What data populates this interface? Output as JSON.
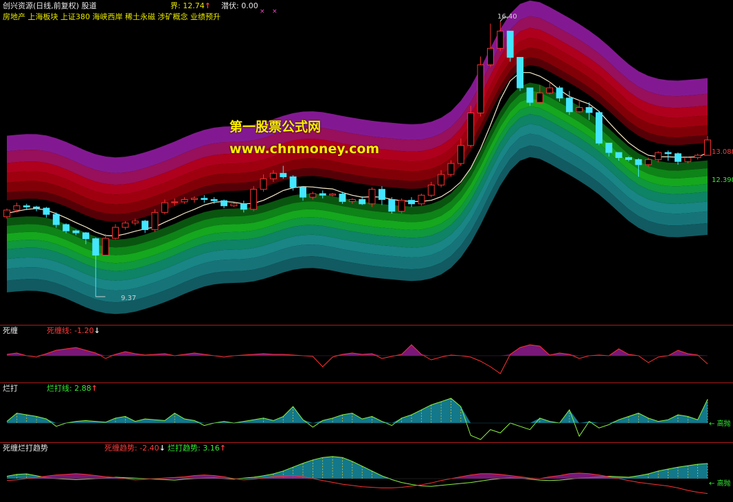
{
  "header": {
    "title": "创兴资源(日线,前复权)",
    "source": "股道",
    "jie_label": "界: ",
    "jie_value": "12.74",
    "jie_arrow": "↑",
    "qianfu_label": "潜伏: ",
    "qianfu_value": "0.00",
    "concepts": "房地产 上海板块 上证380 海峡西岸 稀土永磁 涉矿概念 业绩预升"
  },
  "watermark": {
    "line1": "第一股票公式网",
    "line2": "www.chnmoney.com"
  },
  "main_chart": {
    "price_high_label": "16.40",
    "price_low_label": "9.37",
    "right_label_top": "13.088",
    "right_label_bottom": "12.398",
    "colors": {
      "up": "#ff3030",
      "down": "#44e6ff",
      "ma": "#f4e9c8"
    }
  },
  "panel1": {
    "name": "死缠",
    "line_label": "死缠线: ",
    "line_value": "-1.20",
    "arrow": "↓"
  },
  "panel2": {
    "name": "烂打",
    "line_label": "烂打线: ",
    "line_value": "2.88",
    "arrow": "↑",
    "right_label": "高抛"
  },
  "panel3": {
    "name": "死缠烂打趋势",
    "trend1_label": "死缠趋势: ",
    "trend1_value": "-2.40",
    "trend1_arrow": "↓",
    "trend2_label": "烂打趋势: ",
    "trend2_value": "3.16",
    "trend2_arrow": "↑",
    "right_label": "高抛"
  },
  "chart_data": [
    {
      "type": "candlestick",
      "title": "创兴资源(日线,前复权)",
      "series": [
        {
          "name": "price",
          "candles": [
            [
              11.41,
              11.58,
              11.62,
              11.36
            ],
            [
              11.58,
              11.69,
              11.77,
              11.52
            ],
            [
              11.69,
              11.66,
              11.74,
              11.58
            ],
            [
              11.66,
              11.63,
              11.69,
              11.55
            ],
            [
              11.63,
              11.47,
              11.66,
              11.39
            ],
            [
              11.47,
              11.21,
              11.52,
              11.13
            ],
            [
              11.21,
              11.05,
              11.24,
              10.99
            ],
            [
              11.05,
              11.0,
              11.08,
              10.94
            ],
            [
              11.0,
              10.85,
              11.02,
              10.71
            ],
            [
              10.85,
              10.43,
              10.88,
              9.37
            ],
            [
              10.43,
              10.86,
              10.97,
              10.4
            ],
            [
              10.86,
              11.14,
              11.22,
              10.83
            ],
            [
              11.14,
              11.25,
              11.3,
              11.08
            ],
            [
              11.25,
              11.3,
              11.36,
              11.19
            ],
            [
              11.3,
              11.08,
              11.33,
              11.0
            ],
            [
              11.08,
              11.52,
              11.6,
              11.02
            ],
            [
              11.52,
              11.77,
              11.85,
              11.47
            ],
            [
              11.77,
              11.79,
              11.88,
              11.69
            ],
            [
              11.79,
              11.85,
              11.91,
              11.74
            ],
            [
              11.85,
              11.88,
              11.93,
              11.77
            ],
            [
              11.88,
              11.85,
              11.96,
              11.77
            ],
            [
              11.85,
              11.82,
              11.91,
              11.74
            ],
            [
              11.82,
              11.69,
              11.85,
              11.63
            ],
            [
              11.69,
              11.74,
              11.77,
              11.66
            ],
            [
              11.74,
              11.6,
              11.82,
              11.52
            ],
            [
              11.6,
              12.11,
              12.19,
              11.55
            ],
            [
              12.11,
              12.38,
              12.49,
              12.05
            ],
            [
              12.38,
              12.52,
              12.6,
              12.3
            ],
            [
              12.52,
              12.43,
              12.71,
              12.38
            ],
            [
              12.43,
              12.16,
              12.47,
              12.08
            ],
            [
              12.16,
              11.91,
              12.19,
              11.82
            ],
            [
              11.91,
              12.0,
              12.05,
              11.85
            ],
            [
              12.0,
              11.96,
              12.08,
              11.88
            ],
            [
              11.96,
              11.99,
              12.02,
              11.93
            ],
            [
              11.99,
              11.8,
              12.05,
              11.74
            ],
            [
              11.8,
              11.85,
              11.88,
              11.74
            ],
            [
              11.85,
              11.74,
              11.93,
              11.71
            ],
            [
              11.74,
              12.11,
              12.16,
              11.66
            ],
            [
              12.11,
              11.85,
              12.19,
              11.71
            ],
            [
              11.85,
              11.55,
              11.91,
              11.49
            ],
            [
              11.55,
              11.83,
              11.88,
              11.49
            ],
            [
              11.83,
              11.74,
              11.91,
              11.66
            ],
            [
              11.74,
              11.96,
              12.0,
              11.69
            ],
            [
              11.96,
              12.22,
              12.3,
              11.91
            ],
            [
              12.22,
              12.49,
              12.6,
              12.16
            ],
            [
              12.49,
              12.77,
              12.85,
              12.43
            ],
            [
              12.77,
              13.23,
              13.41,
              12.71
            ],
            [
              13.23,
              14.06,
              14.24,
              13.18
            ],
            [
              14.06,
              15.29,
              15.5,
              13.97
            ],
            [
              15.29,
              15.71,
              16.34,
              15.23
            ],
            [
              15.71,
              16.15,
              16.4,
              15.64
            ],
            [
              16.15,
              15.48,
              15.84,
              15.37
            ],
            [
              15.48,
              14.7,
              14.86,
              14.62
            ],
            [
              14.7,
              14.33,
              14.64,
              14.24
            ],
            [
              14.33,
              14.57,
              14.77,
              14.27
            ],
            [
              14.57,
              14.7,
              14.86,
              14.53
            ],
            [
              14.7,
              14.44,
              14.75,
              14.35
            ],
            [
              14.44,
              14.09,
              14.62,
              14.01
            ],
            [
              14.09,
              14.2,
              14.4,
              14.07
            ],
            [
              14.2,
              14.07,
              14.33,
              13.88
            ],
            [
              14.07,
              13.29,
              14.12,
              13.24
            ],
            [
              13.29,
              13.05,
              13.21,
              12.95
            ],
            [
              13.05,
              12.92,
              13.02,
              12.84
            ],
            [
              12.92,
              12.87,
              12.95,
              12.82
            ],
            [
              12.87,
              12.74,
              12.9,
              12.43
            ],
            [
              12.74,
              12.87,
              12.92,
              12.68
            ],
            [
              12.87,
              13.05,
              13.08,
              12.8
            ],
            [
              13.05,
              13.02,
              13.1,
              12.84
            ],
            [
              13.02,
              12.82,
              13.05,
              12.74
            ],
            [
              12.82,
              12.92,
              12.95,
              12.77
            ],
            [
              12.92,
              12.98,
              13.02,
              12.87
            ],
            [
              12.98,
              13.37,
              13.47,
              12.98
            ]
          ]
        },
        {
          "name": "MA",
          "values": [
            11.5,
            11.55,
            11.6,
            11.62,
            11.58,
            11.49,
            11.38,
            11.26,
            11.15,
            11.02,
            10.93,
            10.92,
            10.97,
            11.04,
            11.1,
            11.15,
            11.27,
            11.38,
            11.5,
            11.6,
            11.71,
            11.78,
            11.8,
            11.78,
            11.74,
            11.75,
            11.83,
            11.95,
            12.08,
            12.15,
            12.18,
            12.17,
            12.14,
            12.12,
            12.03,
            11.96,
            11.91,
            11.92,
            11.91,
            11.85,
            11.82,
            11.8,
            11.8,
            11.83,
            11.92,
            12.08,
            12.3,
            12.65,
            13.15,
            13.75,
            14.4,
            14.88,
            15.09,
            15.09,
            15.0,
            14.85,
            14.65,
            14.48,
            14.38,
            14.29,
            14.1,
            13.82,
            13.55,
            13.3,
            13.12,
            12.98,
            12.94,
            12.94,
            12.93,
            12.93,
            12.94,
            13.04
          ]
        }
      ]
    },
    {
      "type": "line",
      "title": "死缠",
      "series": [
        {
          "name": "死缠线",
          "values": [
            0.2,
            0.4,
            0.0,
            -0.2,
            0.3,
            0.8,
            1.0,
            1.2,
            0.8,
            0.4,
            -0.4,
            0.2,
            0.6,
            0.3,
            0.1,
            0.2,
            0.3,
            0.0,
            0.2,
            0.4,
            0.2,
            0.0,
            -0.2,
            0.0,
            0.1,
            0.2,
            0.3,
            0.2,
            0.2,
            0.1,
            0.0,
            -0.1,
            -1.6,
            -0.2,
            0.2,
            0.4,
            0.2,
            0.3,
            -0.4,
            -0.1,
            0.2,
            1.6,
            0.2,
            -0.6,
            -0.2,
            0.1,
            0.0,
            -0.2,
            -0.8,
            -1.6,
            -2.6,
            0.2,
            1.2,
            1.6,
            1.4,
            0.1,
            0.4,
            0.2,
            -0.4,
            0.0,
            0.1,
            0.0,
            1.0,
            0.2,
            0.0,
            -1.0,
            -0.2,
            0.0,
            0.8,
            0.3,
            0.1,
            -1.2
          ]
        }
      ]
    },
    {
      "type": "line",
      "title": "烂打",
      "series": [
        {
          "name": "烂打线",
          "values": [
            0.2,
            1.2,
            1.0,
            0.8,
            0.5,
            -0.4,
            0.0,
            0.2,
            0.3,
            0.2,
            0.1,
            0.6,
            0.8,
            0.2,
            0.5,
            0.4,
            0.3,
            1.2,
            0.5,
            0.3,
            -0.3,
            0.0,
            0.2,
            0.0,
            0.2,
            0.4,
            0.6,
            0.3,
            0.8,
            2.0,
            0.4,
            -0.5,
            0.3,
            0.6,
            1.0,
            1.2,
            0.5,
            0.8,
            0.2,
            -0.3,
            0.6,
            1.0,
            1.6,
            2.2,
            2.6,
            3.0,
            2.0,
            -1.5,
            -2.0,
            -0.8,
            -1.2,
            0.0,
            -0.4,
            -0.8,
            0.6,
            0.2,
            0.0,
            1.6,
            -1.6,
            0.2,
            -0.6,
            -0.2,
            0.4,
            0.8,
            1.2,
            0.6,
            0.2,
            0.4,
            1.0,
            0.8,
            0.4,
            2.88
          ]
        }
      ]
    },
    {
      "type": "line",
      "title": "死缠烂打趋势",
      "series": [
        {
          "name": "死缠趋势",
          "values": [
            -0.3,
            -0.2,
            0.0,
            0.2,
            0.4,
            0.6,
            0.7,
            0.8,
            0.7,
            0.5,
            0.3,
            0.2,
            0.0,
            -0.2,
            -0.1,
            0.0,
            0.1,
            0.2,
            0.3,
            0.5,
            0.6,
            0.5,
            0.3,
            0.0,
            -0.2,
            -0.1,
            0.1,
            0.3,
            0.4,
            0.5,
            0.3,
            0.0,
            -0.3,
            -0.6,
            -0.9,
            -1.1,
            -1.3,
            -1.4,
            -1.5,
            -1.5,
            -1.4,
            -1.2,
            -1.0,
            -0.7,
            -0.3,
            0.0,
            0.3,
            0.6,
            0.8,
            0.8,
            0.7,
            0.5,
            0.3,
            0.1,
            0.0,
            0.3,
            0.5,
            0.8,
            0.9,
            0.8,
            0.6,
            0.3,
            0.0,
            -0.3,
            -0.6,
            -0.8,
            -1.0,
            -1.2,
            -1.5,
            -1.9,
            -2.2,
            -2.4
          ]
        },
        {
          "name": "烂打趋势",
          "values": [
            0.5,
            0.9,
            1.0,
            0.6,
            0.2,
            0.0,
            -0.1,
            -0.2,
            -0.1,
            0.0,
            0.1,
            0.3,
            0.2,
            0.1,
            0.0,
            -0.1,
            -0.2,
            -0.3,
            -0.1,
            0.0,
            0.1,
            0.2,
            0.0,
            -0.1,
            0.1,
            0.3,
            0.6,
            1.0,
            1.6,
            2.4,
            3.2,
            3.9,
            4.4,
            4.6,
            4.4,
            3.6,
            2.6,
            1.6,
            0.6,
            -0.2,
            -0.8,
            -1.2,
            -1.5,
            -1.6,
            -1.4,
            -1.2,
            -1.0,
            -0.8,
            -0.5,
            -0.2,
            0.0,
            0.2,
            0.1,
            -0.1,
            -0.3,
            -0.4,
            -0.3,
            -0.1,
            0.1,
            0.2,
            0.4,
            0.5,
            0.4,
            0.3,
            0.6,
            1.0,
            1.6,
            2.0,
            2.4,
            2.7,
            3.0,
            3.16
          ]
        }
      ]
    }
  ]
}
